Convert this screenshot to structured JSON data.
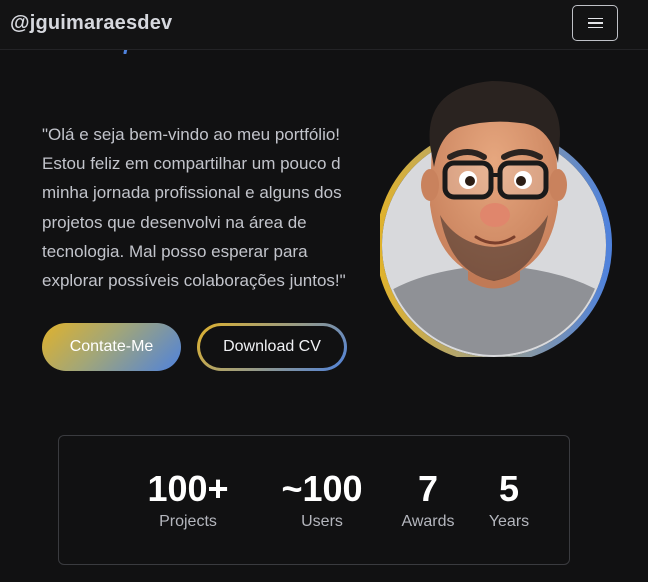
{
  "brand": {
    "handle": "@jguimaraesdev"
  },
  "nav": {
    "menu_icon": "hamburger-icon"
  },
  "intro": {
    "lines": [
      "\"Olá e seja bem-vindo ao meu portfólio!",
      "Estou feliz em compartilhar um pouco d",
      "minha jornada profissional e alguns dos",
      "projetos que desenvolvi na área de",
      "tecnologia. Mal posso esperar para",
      "explorar possíveis colaborações juntos!\""
    ]
  },
  "buttons": {
    "contact_label": "Contate-Me",
    "cv_label": "Download CV"
  },
  "stats": [
    {
      "value": "100+",
      "label": "Projects"
    },
    {
      "value": "~100",
      "label": "Users"
    },
    {
      "value": "7",
      "label": "Awards"
    },
    {
      "value": "5",
      "label": "Years"
    }
  ],
  "colors": {
    "accent_gold": "#e0b22c",
    "accent_blue": "#4f82dc",
    "background": "#111112"
  }
}
